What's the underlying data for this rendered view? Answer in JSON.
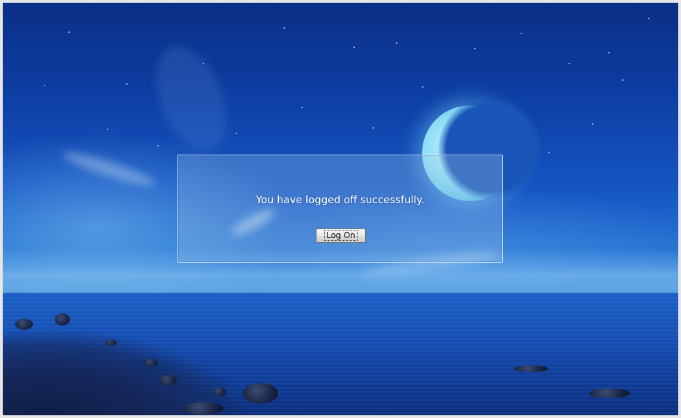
{
  "logoff_dialog": {
    "message": "You have logged off successfully.",
    "logon_button_label": "Log On"
  },
  "wallpaper": {
    "scene": "night-sea-moon",
    "colors": {
      "sky_top": "#0b2f86",
      "sky_horizon": "#5aa3e2",
      "sea": "#1650b6",
      "moon": "#8cdcf5"
    }
  },
  "icons": {
    "moon": "moon-icon"
  }
}
